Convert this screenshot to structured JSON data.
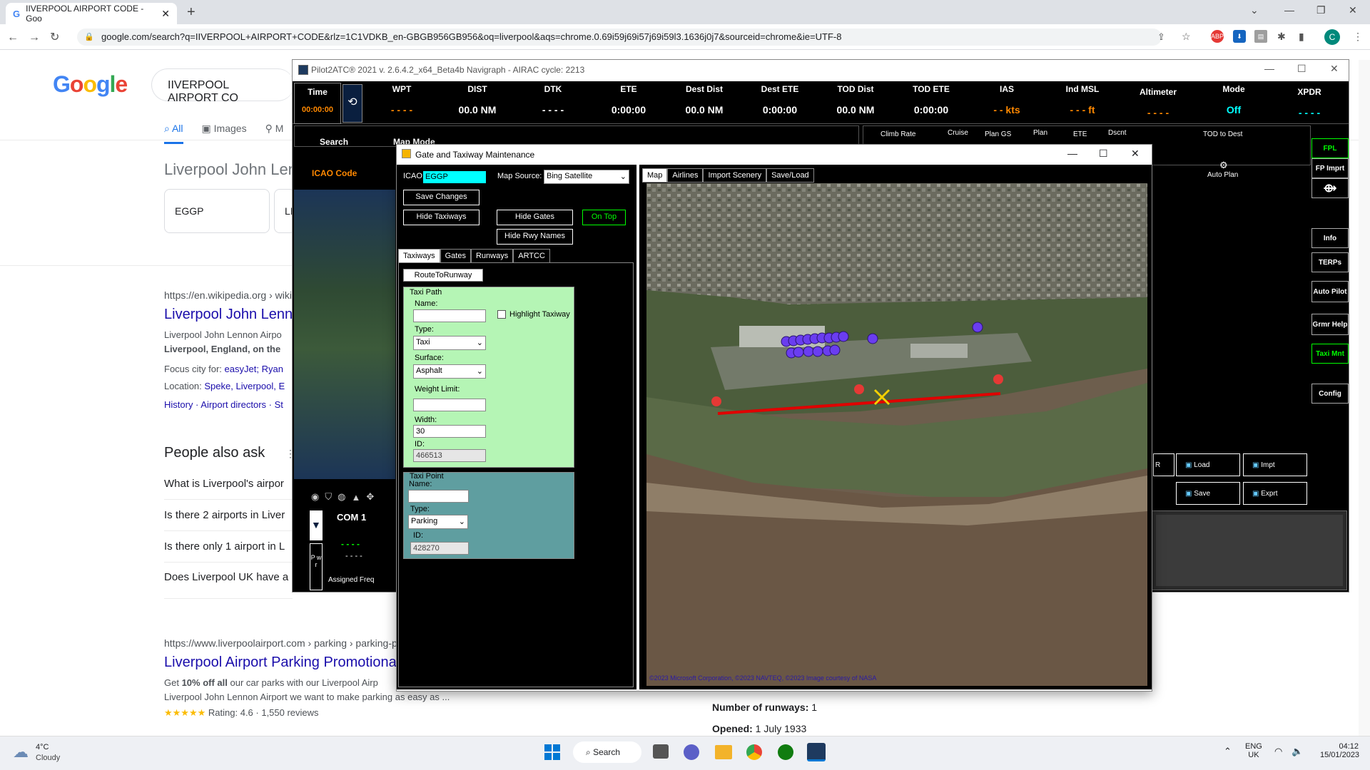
{
  "browser": {
    "tab_title": "IIVERPOOL AIRPORT CODE - Goo",
    "url": "google.com/search?q=IIVERPOOL+AIRPORT+CODE&rlz=1C1VDKB_en-GBGB956GB956&oq=liverpool&aqs=chrome.0.69i59j69i57j69i59l3.1636j0j7&sourceid=chrome&ie=UTF-8",
    "avatar": "C",
    "abp": "ABP"
  },
  "google": {
    "logo": "Google",
    "query": "IIVERPOOL AIRPORT CO",
    "tabs": [
      "All",
      "Images",
      "M"
    ],
    "kp_title": "Liverpool John Len",
    "chip1": "EGGP",
    "chip2": "LI",
    "result1": {
      "url": "https://en.wikipedia.org › wiki",
      "title": "Liverpool John Lenn",
      "snip1": "Liverpool John Lennon Airpo",
      "snip2": "Liverpool, England, on the",
      "focus_label": "Focus city for:",
      "focus_val": "easyJet; Ryan",
      "loc_label": "Location:",
      "loc_val": "Speke, Liverpool, E",
      "links": "History · Airport directors · St"
    },
    "paa_title": "People also ask",
    "paa": [
      "What is Liverpool's airpor",
      "Is there 2 airports in Liver",
      "Is there only 1 airport in L",
      "Does Liverpool UK have a"
    ],
    "result2": {
      "url": "https://www.liverpoolairport.com › parking › parking-p",
      "title": "Liverpool Airport Parking Promotiona",
      "snip1_a": "Get ",
      "snip1_b": "10% off all",
      "snip1_c": " our car parks with our Liverpool Airp",
      "snip2": "Liverpool John Lennon Airport we want to make parking as easy as ...",
      "stars": "★★★★★",
      "rating": "Rating: 4.6 · 1,550 reviews"
    },
    "kp_runways_label": "Number of runways:",
    "kp_runways": "1",
    "kp_opened_label": "Opened:",
    "kp_opened": "1 July 1933"
  },
  "p2a": {
    "title": "Pilot2ATC® 2021 v. 2.6.4.2_x64_Beta4b     Navigraph - AIRAC cycle: 2213",
    "cols": [
      {
        "h": "Time",
        "v": "00:00:00"
      },
      {
        "h": "WPT",
        "v": "- - - -"
      },
      {
        "h": "DIST",
        "v": "00.0 NM"
      },
      {
        "h": "DTK",
        "v": "- - - -"
      },
      {
        "h": "ETE",
        "v": "0:00:00"
      },
      {
        "h": "Dest Dist",
        "v": "00.0 NM"
      },
      {
        "h": "Dest ETE",
        "v": "0:00:00"
      },
      {
        "h": "TOD Dist",
        "v": "00.0 NM"
      },
      {
        "h": "TOD ETE",
        "v": "0:00:00"
      },
      {
        "h": "IAS",
        "v": "- - kts"
      },
      {
        "h": "Ind MSL",
        "v": "- - - ft"
      },
      {
        "h": "Altimeter",
        "v": "- - - -"
      },
      {
        "h": "Mode",
        "v": "Off"
      },
      {
        "h": "XPDR",
        "v": "- - - -"
      }
    ],
    "search": "Search",
    "map_mode": "Map Mode",
    "icao_code": "ICAO Code",
    "plan_cols": [
      "Climb Rate",
      "Cruise",
      "Plan GS",
      "Plan",
      "ETE",
      "Dscnt",
      "TOD to Dest"
    ],
    "auto_plan": "Auto Plan",
    "side": [
      "FPL",
      "FP Imprt",
      "Info",
      "TERPs",
      "Auto Pilot",
      "Grmr Help",
      "Taxi Mnt",
      "Config"
    ],
    "buttons": [
      "Load",
      "Impt",
      "Save",
      "Exprt"
    ],
    "btn_r": "R",
    "com1": "COM 1",
    "com_dash1": "- - - -",
    "com_dash2": "- - - -",
    "assigned": "Assigned Freq",
    "pwr": "P w r"
  },
  "gate": {
    "title": "Gate and Taxiway Maintenance",
    "icao_label": "ICAO:",
    "icao_val": "EGGP",
    "map_source_label": "Map Source:",
    "map_source": "Bing Satellite",
    "save_changes": "Save Changes",
    "hide_taxiways": "Hide Taxiways",
    "hide_gates": "Hide Gates",
    "on_top": "On Top",
    "hide_rwy_names": "Hide Rwy Names",
    "left_tabs": [
      "Taxiways",
      "Gates",
      "Runways",
      "ARTCC"
    ],
    "route_to_runway": "RouteToRunway",
    "taxi_path": "Taxi Path",
    "name_label": "Name:",
    "highlight": "Highlight Taxiway",
    "type_label": "Type:",
    "type_val": "Taxi",
    "surface_label": "Surface:",
    "surface_val": "Asphalt",
    "weight_label": "Weight Limit:",
    "width_label": "Width:",
    "width_val": "30",
    "id_label": "ID:",
    "id_val": "466513",
    "taxi_point": "Taxi Point",
    "tp_name_label": "Name:",
    "tp_type_label": "Type:",
    "tp_type_val": "Parking",
    "tp_id_label": "ID:",
    "tp_id_val": "428270",
    "map_tabs": [
      "Map",
      "Airlines",
      "Import Scenery",
      "Save/Load"
    ],
    "copyright": "©2023 Microsoft Corporation, ©2023 NAVTEQ, ©2023 Image courtesy of NASA"
  },
  "taskbar": {
    "temp": "4°C",
    "weather": "Cloudy",
    "search": "Search",
    "lang1": "ENG",
    "lang2": "UK",
    "time": "04:12",
    "date": "15/01/2023"
  }
}
